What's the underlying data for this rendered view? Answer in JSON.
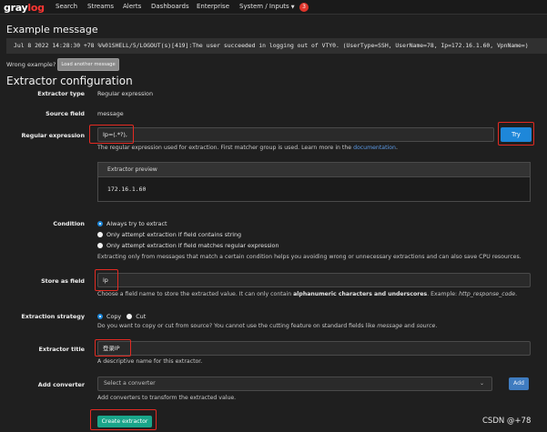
{
  "navbar": {
    "logo_a": "gray",
    "logo_b": "log",
    "items": [
      "Search",
      "Streams",
      "Alerts",
      "Dashboards",
      "Enterprise",
      "System / Inputs"
    ],
    "notification_count": "3"
  },
  "example": {
    "heading": "Example message",
    "message": "Jul  8 2022 14:28:30 +78 %%01SHELL/5/LOGOUT(s)[419]:The user succeeded in logging out of VTY0. (UserType=SSH, UserName=78, Ip=172.16.1.60, VpnName=)",
    "wrong_label": "Wrong example?",
    "load_another_label": "Load another message"
  },
  "config": {
    "heading": "Extractor configuration",
    "extractor_type_label": "Extractor type",
    "extractor_type_value": "Regular expression",
    "source_field_label": "Source field",
    "source_field_value": "message",
    "regex_label": "Regular expression",
    "regex_value": "Ip=(.*?),",
    "try_label": "Try",
    "regex_help_before": "The regular expression used for extraction. First matcher group is used. Learn more in the ",
    "regex_help_link": "documentation",
    "regex_help_after": ".",
    "preview_title": "Extractor preview",
    "preview_value": "172.16.1.60",
    "condition_label": "Condition",
    "condition_options": [
      "Always try to extract",
      "Only attempt extraction if field contains string",
      "Only attempt extraction if field matches regular expression"
    ],
    "condition_selected": 0,
    "condition_help": "Extracting only from messages that match a certain condition helps you avoiding wrong or unnecessary extractions and can also save CPU resources.",
    "store_label": "Store as field",
    "store_value": "ip",
    "store_help_before": "Choose a field name to store the extracted value. It can only contain ",
    "store_help_bold": "alphanumeric characters and underscores",
    "store_help_mid": ". Example: ",
    "store_help_example": "http_response_code",
    "store_help_after": ".",
    "strategy_label": "Extraction strategy",
    "strategy_copy": "Copy",
    "strategy_cut": "Cut",
    "strategy_help_before": "Do you want to copy or cut from source? You cannot use the cutting feature on standard fields like ",
    "strategy_help_message": "message",
    "strategy_help_and": " and ",
    "strategy_help_source": "source",
    "strategy_help_after": ".",
    "title_label": "Extractor title",
    "title_value": "登录IP",
    "title_help": "A descriptive name for this extractor.",
    "converter_label": "Add converter",
    "converter_placeholder": "Select a converter",
    "add_label": "Add",
    "converter_help": "Add converters to transform the extracted value.",
    "create_label": "Create extractor"
  },
  "watermark": "CSDN @+78",
  "colors": {
    "background": "#1f1f1f",
    "accent_blue": "#1e87d9",
    "create_green": "#1aa58a",
    "highlight_red": "#e32a22",
    "logo_red": "#ff3633"
  }
}
